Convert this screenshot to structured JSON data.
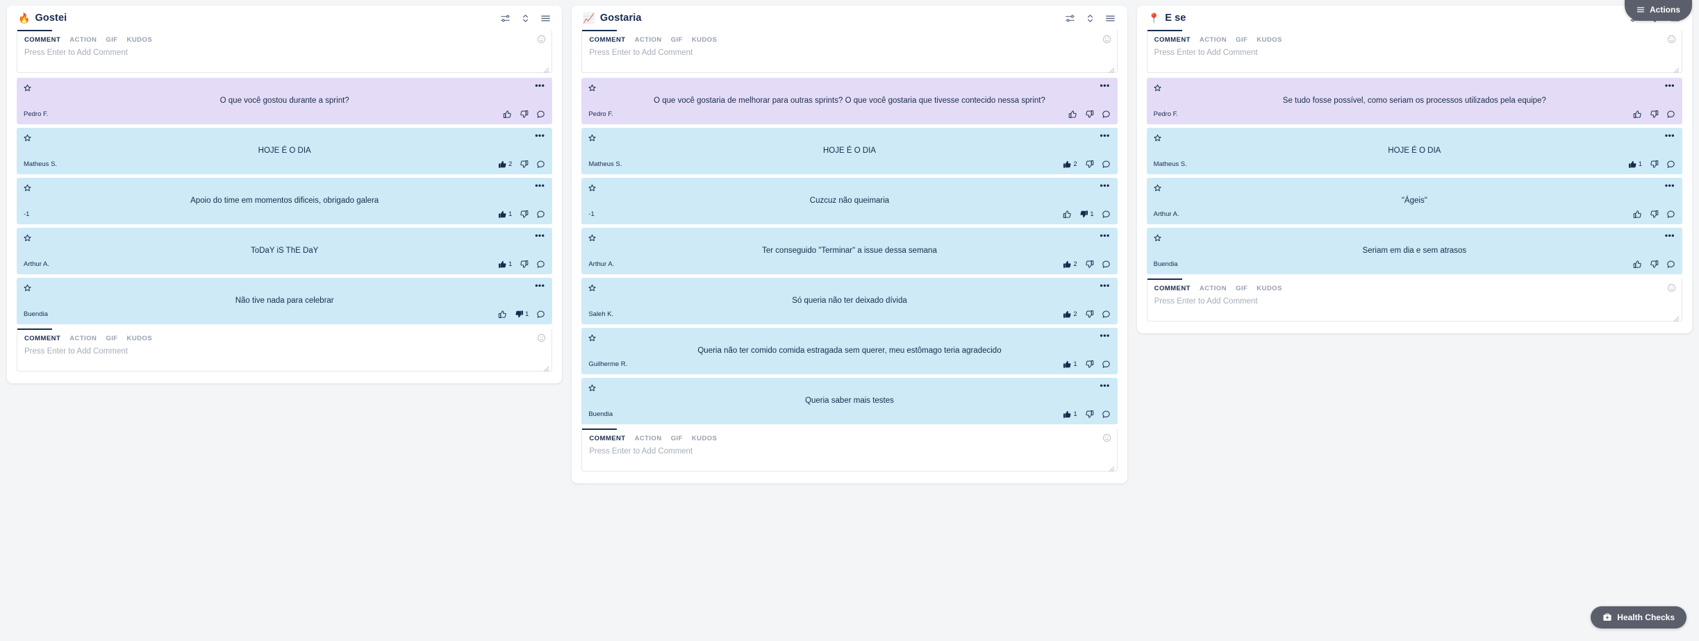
{
  "top_bar": {
    "actions_label": "Actions",
    "actions_icon": "hamburger-icon"
  },
  "floating": {
    "health_label": "Health Checks",
    "health_icon": "medical-kit-icon"
  },
  "composer": {
    "tabs": [
      "COMMENT",
      "ACTION",
      "GIF",
      "KUDOS"
    ],
    "placeholder": "Press Enter to Add Comment",
    "smiley_icon": "smiley-icon",
    "resize_icon": "resize-grip-icon"
  },
  "column_tools": {
    "filter_icon": "filter-sliders-icon",
    "sort_icon": "sort-updown-icon",
    "menu_icon": "hamburger-menu-icon"
  },
  "card_icons": {
    "star": "star-icon",
    "more": "more-options-icon",
    "thumbs_up": "thumbs-up-icon",
    "thumbs_down": "thumbs-down-icon",
    "comment": "comment-bubble-icon"
  },
  "colors": {
    "prompt_card": "#e4dcf7",
    "normal_card": "#cdeaf6",
    "board_bg": "#f4f5f7",
    "floating_btn": "#5b5f6b",
    "text": "#172b4d"
  },
  "columns": [
    {
      "emoji": "🔥",
      "title": "Gostei",
      "composer_top": true,
      "composer_bottom": true,
      "cards": [
        {
          "type": "prompt",
          "text": "O que você gostou durante a sprint?",
          "author": "Pedro F.",
          "up": "",
          "down": "",
          "up_filled": false,
          "down_filled": false
        },
        {
          "type": "normal",
          "text": "HOJE É O DIA",
          "author": "Matheus S.",
          "up": "2",
          "down": "",
          "up_filled": true,
          "down_filled": false
        },
        {
          "type": "normal",
          "text": "Apoio do time em momentos dificeis, obrigado galera",
          "author": "-1",
          "up": "1",
          "down": "",
          "up_filled": true,
          "down_filled": false
        },
        {
          "type": "normal",
          "text": "ToDaY iS ThE DaY",
          "author": "Arthur A.",
          "up": "1",
          "down": "",
          "up_filled": true,
          "down_filled": false
        },
        {
          "type": "normal",
          "text": "Não tive nada para celebrar",
          "author": "Buendia",
          "up": "",
          "down": "1",
          "up_filled": false,
          "down_filled": true
        }
      ]
    },
    {
      "emoji": "📈",
      "title": "Gostaria",
      "composer_top": true,
      "composer_bottom": true,
      "cards": [
        {
          "type": "prompt",
          "text": "O que você gostaria de melhorar para outras sprints? O que você gostaria que tivesse contecido nessa sprint?",
          "author": "Pedro F.",
          "up": "",
          "down": "",
          "up_filled": false,
          "down_filled": false
        },
        {
          "type": "normal",
          "text": "HOJE É O DIA",
          "author": "Matheus S.",
          "up": "2",
          "down": "",
          "up_filled": true,
          "down_filled": false
        },
        {
          "type": "normal",
          "text": "Cuzcuz não queimaria",
          "author": "-1",
          "up": "",
          "down": "1",
          "up_filled": false,
          "down_filled": true
        },
        {
          "type": "normal",
          "text": "Ter conseguido \"Terminar\" a issue dessa semana",
          "author": "Arthur A.",
          "up": "2",
          "down": "",
          "up_filled": true,
          "down_filled": false
        },
        {
          "type": "normal",
          "text": "Só queria não ter deixado dívida",
          "author": "Saleh K.",
          "up": "2",
          "down": "",
          "up_filled": true,
          "down_filled": false
        },
        {
          "type": "normal",
          "text": "Queria não ter comido comida estragada sem querer, meu estômago teria agradecido",
          "author": "Guilherme R.",
          "up": "1",
          "down": "",
          "up_filled": true,
          "down_filled": false
        },
        {
          "type": "normal",
          "text": "Queria saber mais testes",
          "author": "Buendia",
          "up": "1",
          "down": "",
          "up_filled": true,
          "down_filled": false
        }
      ]
    },
    {
      "emoji": "📍",
      "title": "E se",
      "composer_top": true,
      "composer_bottom": true,
      "cards": [
        {
          "type": "prompt",
          "text": "Se tudo fosse possível, como seriam os processos utilizados pela equipe?",
          "author": "Pedro F.",
          "up": "",
          "down": "",
          "up_filled": false,
          "down_filled": false
        },
        {
          "type": "normal",
          "text": "HOJE É O DIA",
          "author": "Matheus S.",
          "up": "1",
          "down": "",
          "up_filled": true,
          "down_filled": false
        },
        {
          "type": "normal",
          "text": "\"Ágeis\"",
          "author": "Arthur A.",
          "up": "",
          "down": "",
          "up_filled": false,
          "down_filled": false
        },
        {
          "type": "normal",
          "text": "Seriam em dia e sem atrasos",
          "author": "Buendia",
          "up": "",
          "down": "",
          "up_filled": false,
          "down_filled": false
        }
      ]
    }
  ]
}
